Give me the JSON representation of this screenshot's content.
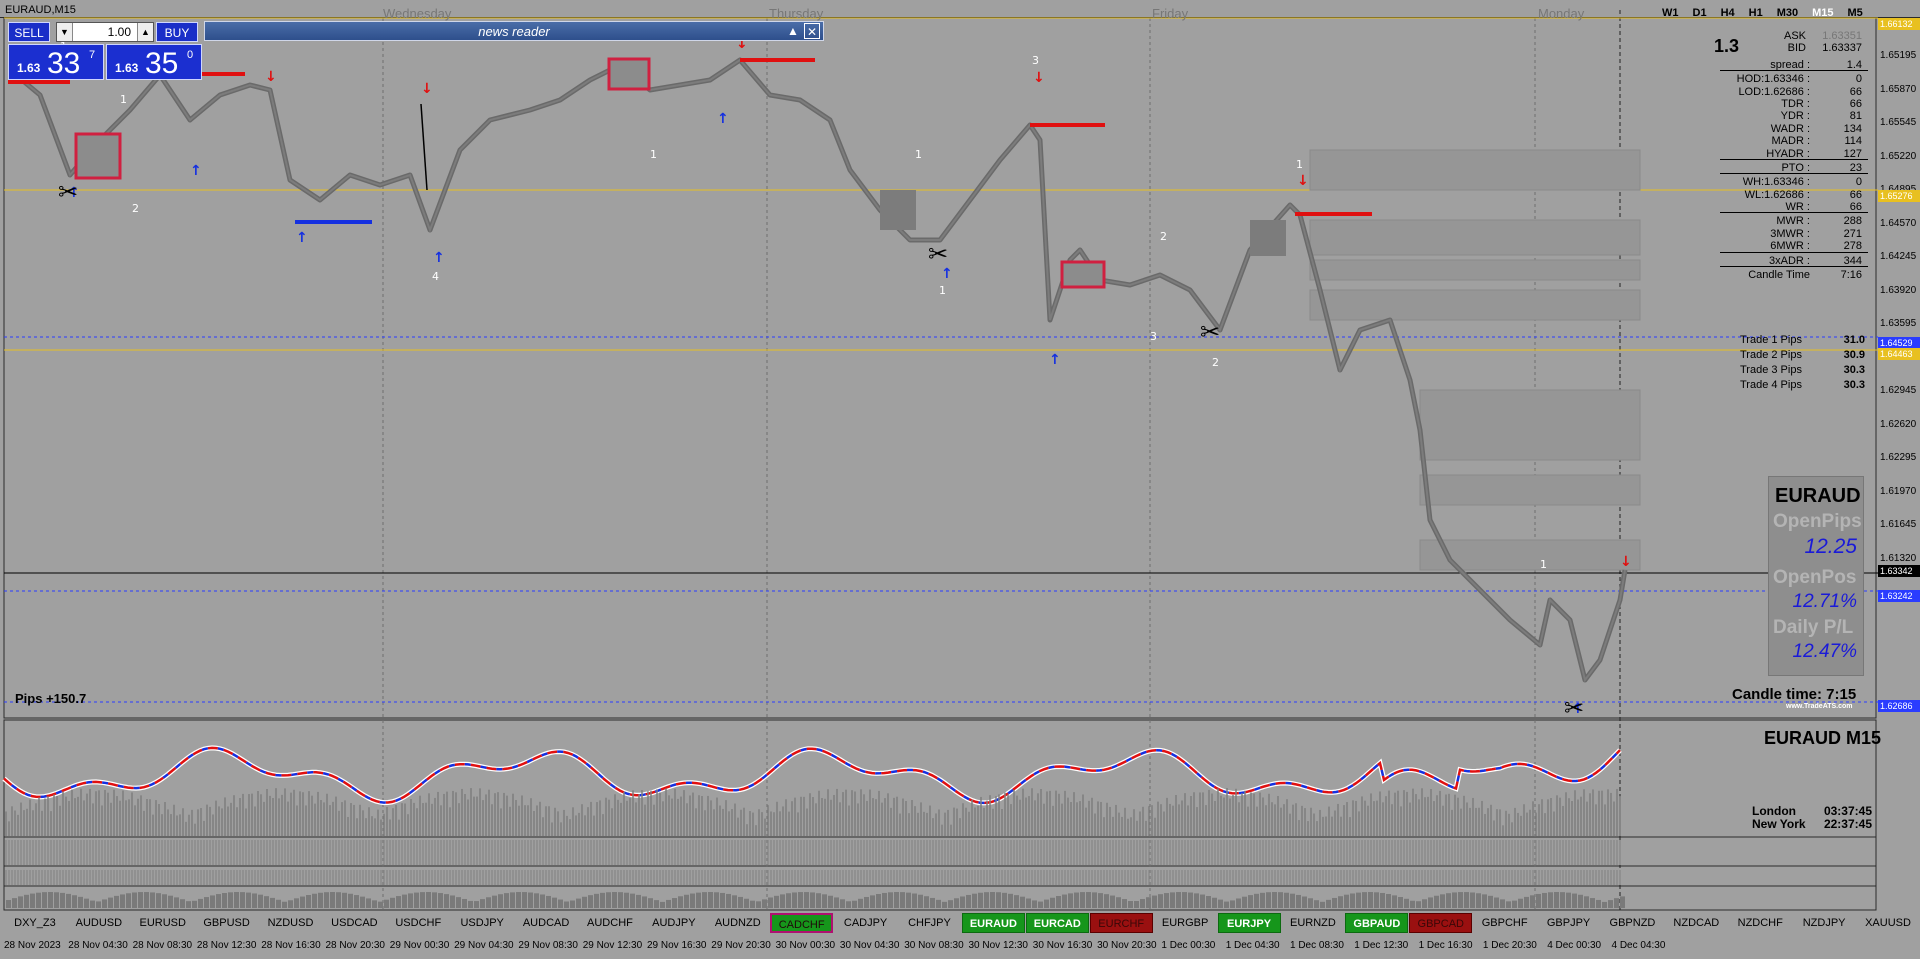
{
  "window": {
    "symbol_title": "EURAUD,M15"
  },
  "timeframes": [
    "W1",
    "D1",
    "H4",
    "H1",
    "M30",
    "M15",
    "M5"
  ],
  "active_timeframe": "M15",
  "day_labels": [
    "Wednesday",
    "Thursday",
    "Friday",
    "Monday"
  ],
  "trade_panel": {
    "sell_label": "SELL",
    "buy_label": "BUY",
    "lot_value": "1.00",
    "bid_prefix": "1.63",
    "bid_big": "33",
    "bid_sup": "7",
    "ask_prefix": "1.63",
    "ask_big": "35",
    "ask_sup": "0"
  },
  "news_reader": {
    "title": "news reader"
  },
  "info_panel": {
    "spread_big": "1.3",
    "ask_label": "ASK",
    "ask_value": "1.63351",
    "bid_label": "BID",
    "bid_value": "1.63337",
    "rows": [
      {
        "label": "spread :",
        "value": "1.4",
        "sep": true
      },
      {
        "label": "HOD:1.63346 :",
        "value": "0"
      },
      {
        "label": "LOD:1.62686 :",
        "value": "66"
      },
      {
        "label": "TDR :",
        "value": "66"
      },
      {
        "label": "YDR :",
        "value": "81"
      },
      {
        "label": "WADR :",
        "value": "134"
      },
      {
        "label": "MADR :",
        "value": "114"
      },
      {
        "label": "HYADR :",
        "value": "127",
        "sep": true
      },
      {
        "label": "PTO :",
        "value": "23",
        "sep": true
      },
      {
        "label": "WH:1.63346 :",
        "value": "0"
      },
      {
        "label": "WL:1.62686 :",
        "value": "66"
      },
      {
        "label": "WR :",
        "value": "66",
        "sep": true
      },
      {
        "label": "MWR :",
        "value": "288"
      },
      {
        "label": "3MWR :",
        "value": "271"
      },
      {
        "label": "6MWR :",
        "value": "278",
        "sep": true
      },
      {
        "label": "3xADR :",
        "value": "344",
        "sep": true
      },
      {
        "label": "Candle Time",
        "value": "7:16"
      }
    ]
  },
  "trades": [
    {
      "label": "Trade 1 Pips",
      "value": "31.0"
    },
    {
      "label": "Trade 2 Pips",
      "value": "30.9"
    },
    {
      "label": "Trade 3 Pips",
      "value": "30.3"
    },
    {
      "label": "Trade 4 Pips",
      "value": "30.3"
    }
  ],
  "price_scale": [
    "1.65195",
    "1.65870",
    "1.65545",
    "1.65220",
    "1.64895",
    "1.64570",
    "1.64245",
    "1.63920",
    "1.63595",
    "1.63270",
    "1.62945",
    "1.62620",
    "1.62295",
    "1.61970",
    "1.61645",
    "1.61320"
  ],
  "price_tags": [
    {
      "value": "1.66132",
      "color": "#e8c020"
    },
    {
      "value": "1.65276",
      "color": "#e8c020"
    },
    {
      "value": "1.64529",
      "color": "#2a3cff"
    },
    {
      "value": "1.64463",
      "color": "#e8c020"
    },
    {
      "value": "1.63342",
      "color": "#000000"
    },
    {
      "value": "1.63242",
      "color": "#2a3cff"
    },
    {
      "value": "1.62686",
      "color": "#2a3cff"
    }
  ],
  "big_panel": {
    "symbol": "EURAUD",
    "open_pips_label": "OpenPips",
    "open_pips_value": "12.25",
    "open_pos_label": "OpenPos",
    "open_pos_value": "12.71%",
    "daily_pl_label": "Daily P/L",
    "daily_pl_value": "12.47%",
    "watermark": "www.TradeATS.com"
  },
  "candle_time": "Candle time:  7:15",
  "pips_label": "Pips +150.7",
  "sub_title": "EURAUD  M15",
  "clocks": [
    {
      "city": "London",
      "time": "03:37:45"
    },
    {
      "city": "New York",
      "time": "22:37:45"
    }
  ],
  "symbols": [
    {
      "name": "DXY_Z3",
      "style": ""
    },
    {
      "name": "AUDUSD",
      "style": ""
    },
    {
      "name": "EURUSD",
      "style": ""
    },
    {
      "name": "GBPUSD",
      "style": ""
    },
    {
      "name": "NZDUSD",
      "style": ""
    },
    {
      "name": "USDCAD",
      "style": ""
    },
    {
      "name": "USDCHF",
      "style": ""
    },
    {
      "name": "USDJPY",
      "style": ""
    },
    {
      "name": "AUDCAD",
      "style": ""
    },
    {
      "name": "AUDCHF",
      "style": ""
    },
    {
      "name": "AUDJPY",
      "style": ""
    },
    {
      "name": "AUDNZD",
      "style": ""
    },
    {
      "name": "CADCHF",
      "style": "gb"
    },
    {
      "name": "CADJPY",
      "style": ""
    },
    {
      "name": "CHFJPY",
      "style": ""
    },
    {
      "name": "EURAUD",
      "style": "g"
    },
    {
      "name": "EURCAD",
      "style": "g"
    },
    {
      "name": "EURCHF",
      "style": "r"
    },
    {
      "name": "EURGBP",
      "style": ""
    },
    {
      "name": "EURJPY",
      "style": "g"
    },
    {
      "name": "EURNZD",
      "style": ""
    },
    {
      "name": "GBPAUD",
      "style": "g"
    },
    {
      "name": "GBPCAD",
      "style": "r"
    },
    {
      "name": "GBPCHF",
      "style": ""
    },
    {
      "name": "GBPJPY",
      "style": ""
    },
    {
      "name": "GBPNZD",
      "style": ""
    },
    {
      "name": "NZDCAD",
      "style": ""
    },
    {
      "name": "NZDCHF",
      "style": ""
    },
    {
      "name": "NZDJPY",
      "style": ""
    },
    {
      "name": "XAUUSD",
      "style": ""
    }
  ],
  "time_labels": [
    "28 Nov 2023",
    "28 Nov 04:30",
    "28 Nov 08:30",
    "28 Nov 12:30",
    "28 Nov 16:30",
    "28 Nov 20:30",
    "29 Nov 00:30",
    "29 Nov 04:30",
    "29 Nov 08:30",
    "29 Nov 12:30",
    "29 Nov 16:30",
    "29 Nov 20:30",
    "30 Nov 00:30",
    "30 Nov 04:30",
    "30 Nov 08:30",
    "30 Nov 12:30",
    "30 Nov 16:30",
    "30 Nov 20:30",
    "1 Dec 00:30",
    "1 Dec 04:30",
    "1 Dec 08:30",
    "1 Dec 12:30",
    "1 Dec 16:30",
    "1 Dec 20:30",
    "4 Dec 00:30",
    "4 Dec 04:30"
  ],
  "chart_labels": [
    "1",
    "2",
    "1",
    "4",
    "1",
    "3",
    "1",
    "2",
    "2",
    "1",
    "3",
    "1",
    "1"
  ]
}
